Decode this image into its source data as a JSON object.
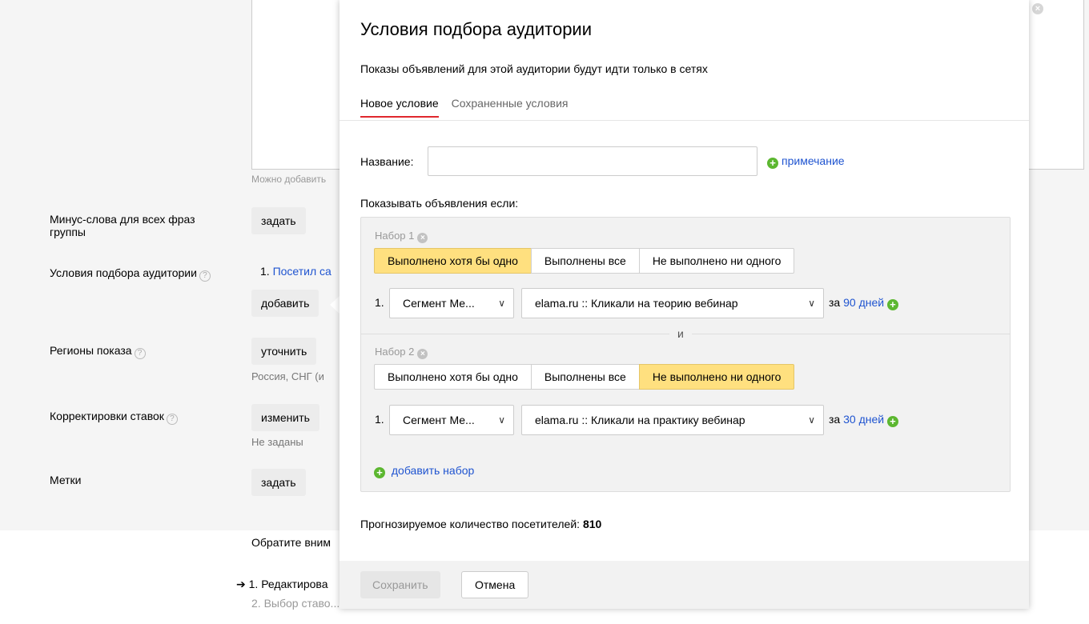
{
  "background": {
    "hint": "Можно добавить",
    "rows": [
      {
        "label": "Минус-слова для всех фраз группы",
        "button": "задать"
      },
      {
        "label": "Условия подбора аудитории",
        "item_num": "1.",
        "item_link": "Посетил са",
        "button": "добавить"
      },
      {
        "label": "Регионы показа",
        "button": "уточнить",
        "sub": "Россия, СНГ (и"
      },
      {
        "label": "Корректировки ставок",
        "button": "изменить",
        "sub": "Не заданы"
      },
      {
        "label": "Метки",
        "button": "задать"
      }
    ],
    "notice": "Обратите вним",
    "steps": [
      "1. Редактирова",
      "2. Выбор ставо..."
    ]
  },
  "modal": {
    "title": "Условия подбора аудитории",
    "description": "Показы объявлений для этой аудитории будут идти только в сетях",
    "tabs": [
      {
        "label": "Новое условие",
        "active": true
      },
      {
        "label": "Сохраненные условия",
        "active": false
      }
    ],
    "name_label": "Название:",
    "name_value": "",
    "note_link": "примечание",
    "show_if": "Показывать объявления если:",
    "sets": [
      {
        "title": "Набор 1",
        "options": [
          "Выполнено хотя бы одно",
          "Выполнены все",
          "Не выполнено ни одного"
        ],
        "selected": 0,
        "condition": {
          "num": "1.",
          "type": "Сегмент Ме...",
          "segment": "elama.ru :: Кликали на теорию вебинар",
          "for_label": "за",
          "days": "90 дней"
        }
      },
      {
        "title": "Набор 2",
        "options": [
          "Выполнено хотя бы одно",
          "Выполнены все",
          "Не выполнено ни одного"
        ],
        "selected": 2,
        "condition": {
          "num": "1.",
          "type": "Сегмент Ме...",
          "segment": "elama.ru :: Кликали на практику вебинар",
          "for_label": "за",
          "days": "30 дней"
        }
      }
    ],
    "and_label": "и",
    "add_set": "добавить набор",
    "forecast_label": "Прогнозируемое количество посетителей:",
    "forecast_value": "810",
    "save": "Сохранить",
    "cancel": "Отмена"
  },
  "colors": {
    "link": "#1f54d0",
    "selected": "#ffe07f",
    "plus": "#5cb730",
    "tab_underline": "#e0272d"
  }
}
